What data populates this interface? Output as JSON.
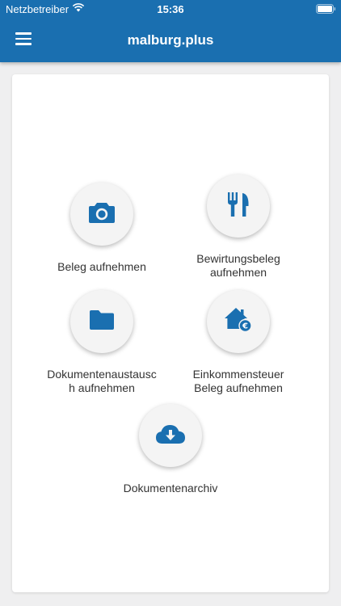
{
  "status_bar": {
    "carrier": "Netzbetreiber",
    "time": "15:36"
  },
  "header": {
    "title": "malburg.plus",
    "menu_icon": "hamburger-menu-icon",
    "background_color": "#1a6fb0"
  },
  "actions": [
    {
      "label": "Beleg aufnehmen",
      "icon": "camera-icon"
    },
    {
      "label": "Bewirtungsbeleg\naufnehmen",
      "icon": "fork-knife-icon"
    },
    {
      "label": "Dokumentenaustausc\nh aufnehmen",
      "icon": "folder-icon"
    },
    {
      "label": "Einkommensteuer\nBeleg aufnehmen",
      "icon": "house-euro-icon"
    },
    {
      "label": "Dokumentenarchiv",
      "icon": "cloud-download-icon"
    }
  ],
  "colors": {
    "icon": "#1a6fb0",
    "circle_bg": "#f4f4f4",
    "label_text": "#333333"
  }
}
